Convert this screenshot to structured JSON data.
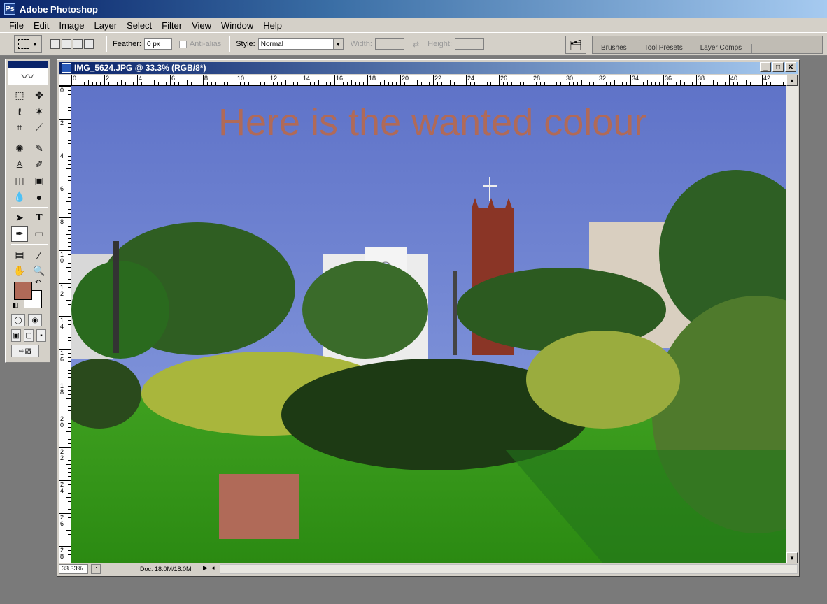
{
  "app": {
    "title": "Adobe Photoshop"
  },
  "menu": [
    "File",
    "Edit",
    "Image",
    "Layer",
    "Select",
    "Filter",
    "View",
    "Window",
    "Help"
  ],
  "options": {
    "feather_label": "Feather:",
    "feather_value": "0 px",
    "antialias_label": "Anti-alias",
    "style_label": "Style:",
    "style_value": "Normal",
    "width_label": "Width:",
    "height_label": "Height:"
  },
  "palette_well": {
    "tabs": [
      "Brushes",
      "Tool Presets",
      "Layer Comps"
    ]
  },
  "toolbox": {
    "foreground_color": "#b06a58",
    "background_color": "#ffffff"
  },
  "document": {
    "title": "IMG_5624.JPG @ 33.3% (RGB/8*)",
    "zoom": "33.33%",
    "doc_size": "Doc: 18.0M/18.0M",
    "ruler_h": [
      "0",
      "2",
      "4",
      "6",
      "8",
      "10",
      "12",
      "14",
      "16",
      "18",
      "20",
      "22",
      "24",
      "26",
      "28",
      "30",
      "32",
      "34",
      "36",
      "38",
      "40",
      "42"
    ],
    "ruler_v": [
      "0",
      "2",
      "4",
      "6",
      "8",
      "10",
      "12",
      "14",
      "16",
      "18",
      "20",
      "22",
      "24",
      "26",
      "28"
    ],
    "canvas_text": "Here is the wanted colour",
    "canvas_text_color": "#b06a58",
    "swatch_color": "#b06a58"
  }
}
